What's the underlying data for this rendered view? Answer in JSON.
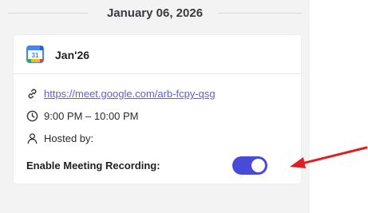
{
  "date_separator": "January 06, 2026",
  "event": {
    "title": "Jan'26",
    "calendar_icon": "google-calendar-icon",
    "calendar_day": "31",
    "meeting_link": "https://meet.google.com/arb-fcpy-qsg",
    "time": "9:00 PM – 10:00 PM",
    "hosted_by_label": "Hosted by:",
    "recording": {
      "label": "Enable Meeting Recording:",
      "enabled": true
    }
  },
  "colors": {
    "accent": "#4a4ad8",
    "link": "#5d5fd6",
    "annotation_arrow": "#e02020"
  }
}
